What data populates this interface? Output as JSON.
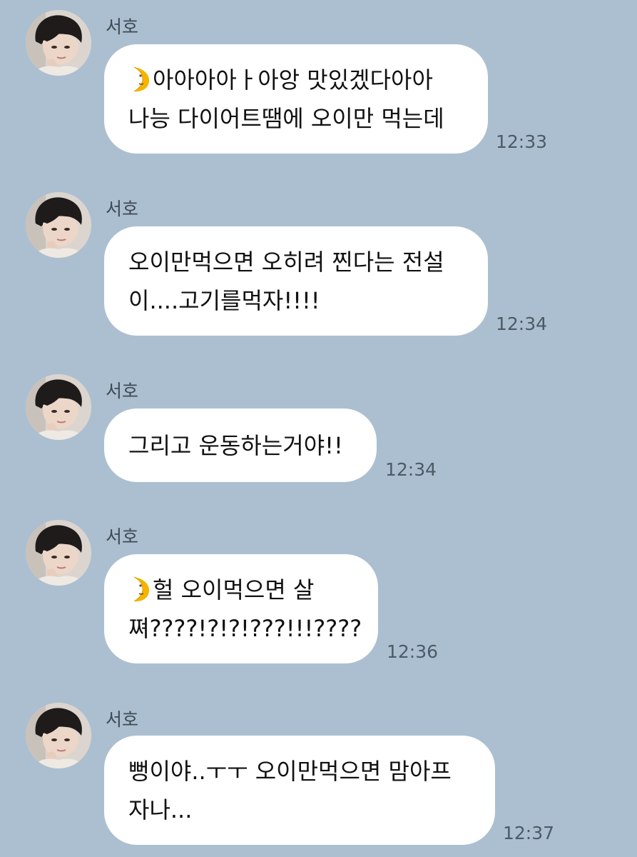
{
  "colors": {
    "background": "#abbfd0",
    "bubble": "#ffffff",
    "text": "#111111",
    "meta_text": "#4d5a67"
  },
  "messages": [
    {
      "sender": "서호",
      "avatar_icon": "profile-photo-icon",
      "lines": [
        "아아아아ㅏ아앙 맛있겠다아아",
        "나능 다이어트땜에 오이만 먹는데"
      ],
      "emoji_icon": "first-quarter-moon-face-icon",
      "time": "12:33"
    },
    {
      "sender": "서호",
      "avatar_icon": "profile-photo-icon",
      "lines": [
        "오이만먹으면 오히려 찐다는 전설",
        "이....고기를먹자!!!!"
      ],
      "time": "12:34"
    },
    {
      "sender": "서호",
      "avatar_icon": "profile-photo-icon",
      "lines": [
        "그리고 운동하는거야!!"
      ],
      "time": "12:34"
    },
    {
      "sender": "서호",
      "avatar_icon": "profile-photo-icon",
      "lines": [
        "헐 오이먹으면 살",
        "쪄????!?!?!???!!!????"
      ],
      "emoji_icon": "first-quarter-moon-face-icon",
      "time": "12:36"
    },
    {
      "sender": "서호",
      "avatar_icon": "profile-photo-icon",
      "lines": [
        "뻥이야..ㅜㅜ 오이만먹으면 맘아프",
        "자나..."
      ],
      "time": "12:37"
    }
  ]
}
